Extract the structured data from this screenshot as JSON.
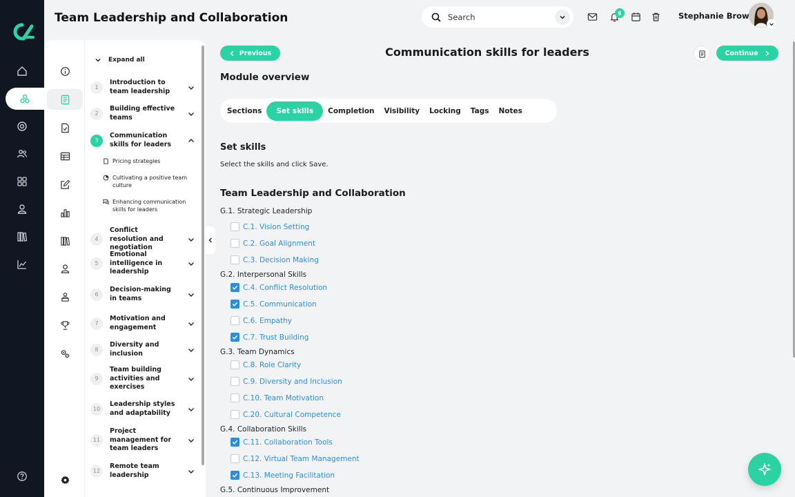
{
  "header": {
    "title": "Team Leadership and Collaboration",
    "search_placeholder": "Search",
    "notification_count": "6",
    "user_name": "Stephanie Brown"
  },
  "tree": {
    "expand_all": "Expand all",
    "modules": [
      {
        "num": "1",
        "title": "Introduction to team leadership"
      },
      {
        "num": "2",
        "title": "Building effective teams"
      },
      {
        "num": "3",
        "title": "Communication skills for leaders"
      },
      {
        "num": "4",
        "title": "Conflict resolution and negotiation"
      },
      {
        "num": "5",
        "title": "Emotional intelligence in leadership"
      },
      {
        "num": "6",
        "title": "Decision-making in teams"
      },
      {
        "num": "7",
        "title": "Motivation and engagement"
      },
      {
        "num": "8",
        "title": "Diversity and inclusion"
      },
      {
        "num": "9",
        "title": "Team building activities and exercises"
      },
      {
        "num": "10",
        "title": "Leadership styles and adaptability"
      },
      {
        "num": "11",
        "title": "Project management for team leaders"
      },
      {
        "num": "12",
        "title": "Remote team leadership"
      }
    ],
    "subitems": [
      {
        "label": "Pricing strategies",
        "icon": "document-icon"
      },
      {
        "label": "Cultivating a positive team culture",
        "icon": "pie-chart-icon"
      },
      {
        "label": "Enhancing communication skills for leaders",
        "icon": "chat-icon"
      }
    ]
  },
  "main": {
    "previous_label": "Previous",
    "continue_label": "Continue",
    "title": "Communication skills for leaders",
    "section_title": "Module overview",
    "tabs": [
      "Sections",
      "Set skills",
      "Completion",
      "Visibility",
      "Locking",
      "Tags",
      "Notes"
    ],
    "active_tab": "Set skills",
    "set_title": "Set skills",
    "set_desc": "Select the skills and click Save.",
    "group_title": "Team Leadership and Collaboration",
    "categories": [
      {
        "label": "G.1. Strategic Leadership",
        "skills": [
          {
            "label": "C.1. Vision Setting",
            "checked": false
          },
          {
            "label": "C.2. Goal Alignment",
            "checked": false
          },
          {
            "label": "C.3. Decision Making",
            "checked": false
          }
        ]
      },
      {
        "label": "G.2. Interpersonal Skills",
        "skills": [
          {
            "label": "C.4. Conflict Resolution",
            "checked": true
          },
          {
            "label": "C.5. Communication",
            "checked": true
          },
          {
            "label": "C.6. Empathy",
            "checked": false
          },
          {
            "label": "C.7. Trust Building",
            "checked": true
          }
        ]
      },
      {
        "label": "G.3. Team Dynamics",
        "skills": [
          {
            "label": "C.8. Role Clarity",
            "checked": false
          },
          {
            "label": "C.9. Diversity and Inclusion",
            "checked": false
          },
          {
            "label": "C.10. Team Motivation",
            "checked": false
          },
          {
            "label": "C.20. Cultural Competence",
            "checked": false
          }
        ]
      },
      {
        "label": "G.4. Collaboration Skills",
        "skills": [
          {
            "label": "C.11. Collaboration Tools",
            "checked": true
          },
          {
            "label": "C.12. Virtual Team Management",
            "checked": false
          },
          {
            "label": "C.13. Meeting Facilitation",
            "checked": true
          }
        ]
      },
      {
        "label": "G.5. Continuous Improvement",
        "skills": []
      }
    ]
  },
  "colors": {
    "accent": "#2bd3a4",
    "link": "#2f8dd6",
    "rail": "#111722"
  }
}
